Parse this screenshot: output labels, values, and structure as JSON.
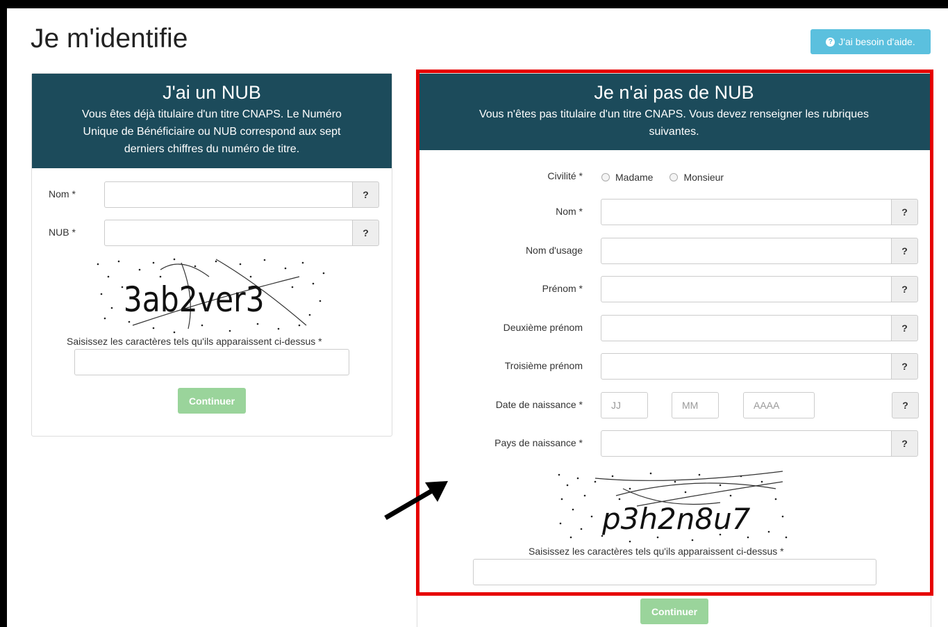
{
  "page_title": "Je m'identifie",
  "help_button": "J'ai besoin d'aide.",
  "left_panel": {
    "title": "J'ai un NUB",
    "description_lines": [
      "Vous êtes déjà titulaire d'un titre CNAPS. Le Numéro",
      "Unique de Bénéficiaire ou NUB correspond aux sept",
      "derniers chiffres du numéro de titre."
    ],
    "fields": [
      {
        "label": "Nom *",
        "help": "?"
      },
      {
        "label": "NUB *",
        "help": "?"
      }
    ],
    "captcha_text": "3ab2ver3",
    "captcha_caption": "Saisissez les caractères tels qu'ils apparaissent ci-dessus *",
    "continue_label": "Continuer"
  },
  "right_panel": {
    "title": "Je n'ai pas de NUB",
    "description_lines": [
      "Vous n'êtes pas titulaire d'un titre CNAPS. Vous devez renseigner les rubriques",
      "suivantes."
    ],
    "civilite_label": "Civilité *",
    "civilite_options": [
      "Madame",
      "Monsieur"
    ],
    "fields": [
      {
        "label": "Nom *",
        "help": "?"
      },
      {
        "label": "Nom d'usage",
        "help": "?"
      },
      {
        "label": "Prénom *",
        "help": "?"
      },
      {
        "label": "Deuxième prénom",
        "help": "?"
      },
      {
        "label": "Troisième prénom",
        "help": "?"
      }
    ],
    "birth_date": {
      "label": "Date de naissance *",
      "placeholders": [
        "JJ",
        "MM",
        "AAAA"
      ],
      "help": "?"
    },
    "birth_country": {
      "label": "Pays de naissance *",
      "help": "?"
    },
    "captcha_text": "p3h2n8u7",
    "captcha_caption": "Saisissez les caractères tels qu'ils apparaissent ci-dessus *",
    "continue_label": "Continuer"
  },
  "colors": {
    "panel_header": "#1c4b5b",
    "help_button": "#5bc0de",
    "continue_button": "#9ad49b",
    "highlight_border": "#e60000"
  }
}
